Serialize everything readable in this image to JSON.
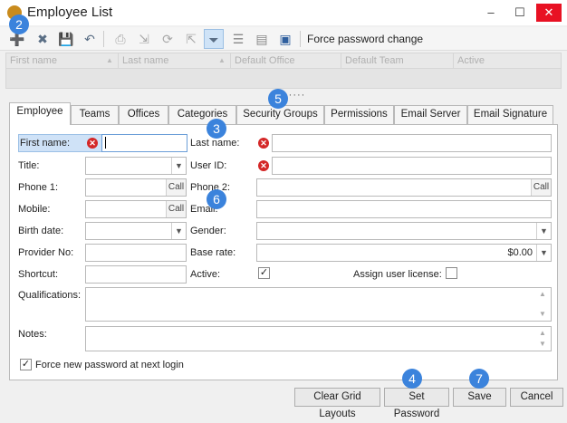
{
  "window": {
    "title": "Employee List",
    "min": "–",
    "max": "☐",
    "close": "✕"
  },
  "toolbar": {
    "force_password_change": "Force password change"
  },
  "grid": {
    "columns": [
      "First name",
      "Last name",
      "Default Office",
      "Default Team",
      "Active"
    ]
  },
  "grip": "·····",
  "tabs": [
    "Employee",
    "Teams",
    "Offices",
    "Categories",
    "Security Groups",
    "Permissions",
    "Email Server",
    "Email Signature"
  ],
  "active_tab": "Employee",
  "form": {
    "first_name": {
      "label": "First name:",
      "value": ""
    },
    "last_name": {
      "label": "Last name:",
      "value": ""
    },
    "title": {
      "label": "Title:",
      "value": ""
    },
    "user_id": {
      "label": "User ID:",
      "value": ""
    },
    "phone1": {
      "label": "Phone 1:",
      "value": "",
      "call": "Call"
    },
    "phone2": {
      "label": "Phone 2:",
      "value": "",
      "call": "Call"
    },
    "mobile": {
      "label": "Mobile:",
      "value": "",
      "call": "Call"
    },
    "email": {
      "label": "Email:",
      "value": ""
    },
    "birth_date": {
      "label": "Birth date:",
      "value": ""
    },
    "gender": {
      "label": "Gender:",
      "value": ""
    },
    "provider_no": {
      "label": "Provider No:",
      "value": ""
    },
    "base_rate": {
      "label": "Base rate:",
      "value": "$0.00"
    },
    "shortcut": {
      "label": "Shortcut:",
      "value": ""
    },
    "active": {
      "label": "Active:",
      "checked": true
    },
    "assign_license": {
      "label": "Assign user license:",
      "checked": false
    },
    "qualifications": {
      "label": "Qualifications:",
      "value": ""
    },
    "notes": {
      "label": "Notes:",
      "value": ""
    },
    "force_new_password": {
      "label": "Force new password at next login",
      "checked": true
    }
  },
  "buttons": {
    "clear_grid": "Clear Grid Layouts",
    "set_password": "Set Password",
    "save": "Save",
    "cancel": "Cancel"
  },
  "badges": [
    "2",
    "5",
    "3",
    "6",
    "4",
    "7"
  ],
  "colors": {
    "badge": "#3b83dc",
    "error": "#d42828",
    "close": "#e81123",
    "selected_label": "#cfe2f7"
  }
}
